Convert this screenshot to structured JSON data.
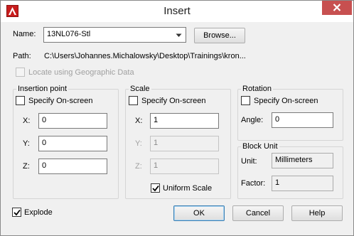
{
  "window": {
    "title": "Insert"
  },
  "name_row": {
    "label": "Name:",
    "value": "13NL076-Stl",
    "browse_label": "Browse..."
  },
  "path_row": {
    "label": "Path:",
    "value": "C:\\Users\\Johannes.Michalowsky\\Desktop\\Trainings\\kron..."
  },
  "geo": {
    "label": "Locate using Geographic Data",
    "checked": false,
    "enabled": false
  },
  "insertion": {
    "title": "Insertion point",
    "specify_label": "Specify On-screen",
    "specify_checked": false,
    "x_label": "X:",
    "x_value": "0",
    "y_label": "Y:",
    "y_value": "0",
    "z_label": "Z:",
    "z_value": "0"
  },
  "scale": {
    "title": "Scale",
    "specify_label": "Specify On-screen",
    "specify_checked": false,
    "x_label": "X:",
    "x_value": "1",
    "y_label": "Y:",
    "y_value": "1",
    "z_label": "Z:",
    "z_value": "1",
    "uniform_label": "Uniform Scale",
    "uniform_checked": true
  },
  "rotation": {
    "title": "Rotation",
    "specify_label": "Specify On-screen",
    "specify_checked": false,
    "angle_label": "Angle:",
    "angle_value": "0"
  },
  "block_unit": {
    "title": "Block Unit",
    "unit_label": "Unit:",
    "unit_value": "Millimeters",
    "factor_label": "Factor:",
    "factor_value": "1"
  },
  "explode": {
    "label": "Explode",
    "checked": true
  },
  "buttons": {
    "ok": "OK",
    "cancel": "Cancel",
    "help": "Help"
  },
  "colors": {
    "close_button": "#c75050",
    "app_icon": "#c81d1d",
    "default_button_border": "#3c7fb1"
  }
}
